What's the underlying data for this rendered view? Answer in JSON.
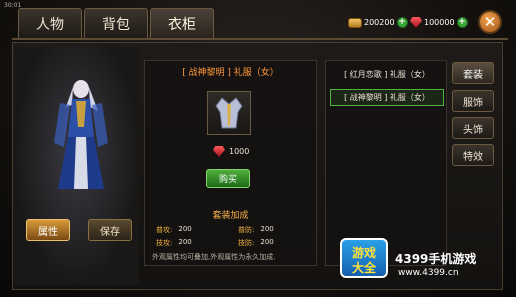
{
  "status": {
    "time": "30:01"
  },
  "tabs": [
    {
      "label": "人物"
    },
    {
      "label": "背包"
    },
    {
      "label": "衣柜"
    }
  ],
  "currency": {
    "coins": "200200",
    "gems": "100000"
  },
  "character": {
    "attributes_label": "属性",
    "save_label": "保存"
  },
  "detail": {
    "title": "[ 战神黎明 ] 礼服（女）",
    "price": "1000",
    "buy_label": "购买",
    "set_bonus_title": "套装加成",
    "stats": [
      {
        "label": "普攻:",
        "value": "200"
      },
      {
        "label": "普防:",
        "value": "200"
      },
      {
        "label": "技攻:",
        "value": "200"
      },
      {
        "label": "技防:",
        "value": "200"
      }
    ],
    "note": "外观属性均可叠加,外观属性为永久加成."
  },
  "list": {
    "items": [
      {
        "label": "[ 红月恋歌 ] 礼服（女）"
      },
      {
        "label": "[ 战神黎明 ] 礼服（女）"
      }
    ]
  },
  "side_tabs": [
    {
      "label": "套装"
    },
    {
      "label": "服饰"
    },
    {
      "label": "头饰"
    },
    {
      "label": "特效"
    }
  ],
  "watermark": {
    "logo_line1": "游戏",
    "logo_line2": "大全",
    "brand": "4399手机游戏",
    "url": "www.4399.cn"
  },
  "colors": {
    "accent": "#ff9a3a",
    "selected": "#4cb63c",
    "buy": "#3a9a2c"
  }
}
